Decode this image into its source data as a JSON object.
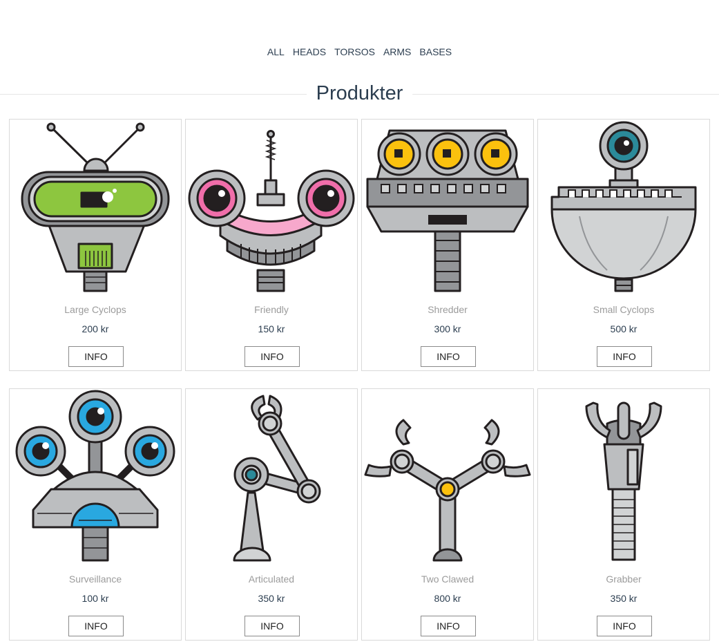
{
  "nav": [
    {
      "label": "ALL"
    },
    {
      "label": "HEADS"
    },
    {
      "label": "TORSOS"
    },
    {
      "label": "ARMS"
    },
    {
      "label": "BASES"
    }
  ],
  "page_title": "Produkter",
  "button_label": "INFO",
  "products": [
    {
      "name": "Large Cyclops",
      "price": "200 kr",
      "icon": "large-cyclops-head"
    },
    {
      "name": "Friendly",
      "price": "150 kr",
      "icon": "friendly-head"
    },
    {
      "name": "Shredder",
      "price": "300 kr",
      "icon": "shredder-head"
    },
    {
      "name": "Small Cyclops",
      "price": "500 kr",
      "icon": "small-cyclops-head"
    },
    {
      "name": "Surveillance",
      "price": "100 kr",
      "icon": "surveillance-head"
    },
    {
      "name": "Articulated",
      "price": "350 kr",
      "icon": "articulated-arm"
    },
    {
      "name": "Two Clawed",
      "price": "800 kr",
      "icon": "two-clawed-arm"
    },
    {
      "name": "Grabber",
      "price": "350 kr",
      "icon": "grabber-arm"
    }
  ],
  "colors": {
    "text": "#2c3e50",
    "muted": "#9b9b9b",
    "border": "#d9d9d9",
    "green": "#8dc63f",
    "pink": "#f06eaa",
    "yellow": "#fbc10e",
    "blue": "#29a8e0",
    "teal": "#2b8a9a",
    "gray": "#bcbec0"
  }
}
